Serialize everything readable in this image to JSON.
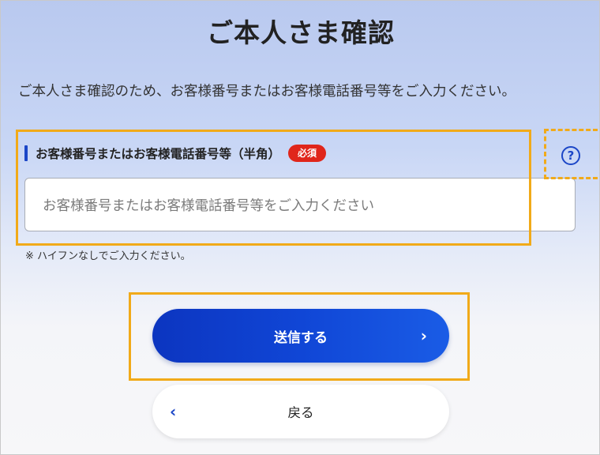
{
  "page": {
    "title": "ご本人さま確認",
    "description": "ご本人さま確認のため、お客様番号またはお客様電話番号等をご入力ください。"
  },
  "form": {
    "field_label": "お客様番号またはお客様電話番号等（半角）",
    "required_badge": "必須",
    "input_placeholder": "お客様番号またはお客様電話番号等をご入力ください",
    "input_value": "",
    "help_icon": "?",
    "note": "※ ハイフンなしでご入力ください。"
  },
  "actions": {
    "submit_label": "送信する",
    "submit_icon": "›",
    "back_label": "戻る",
    "back_icon": "‹"
  },
  "colors": {
    "accent": "#1b46c7",
    "button_gradient_start": "#0c35c0",
    "button_gradient_end": "#1a5ce6",
    "required": "#e0261b",
    "highlight": "#f1aa19"
  }
}
